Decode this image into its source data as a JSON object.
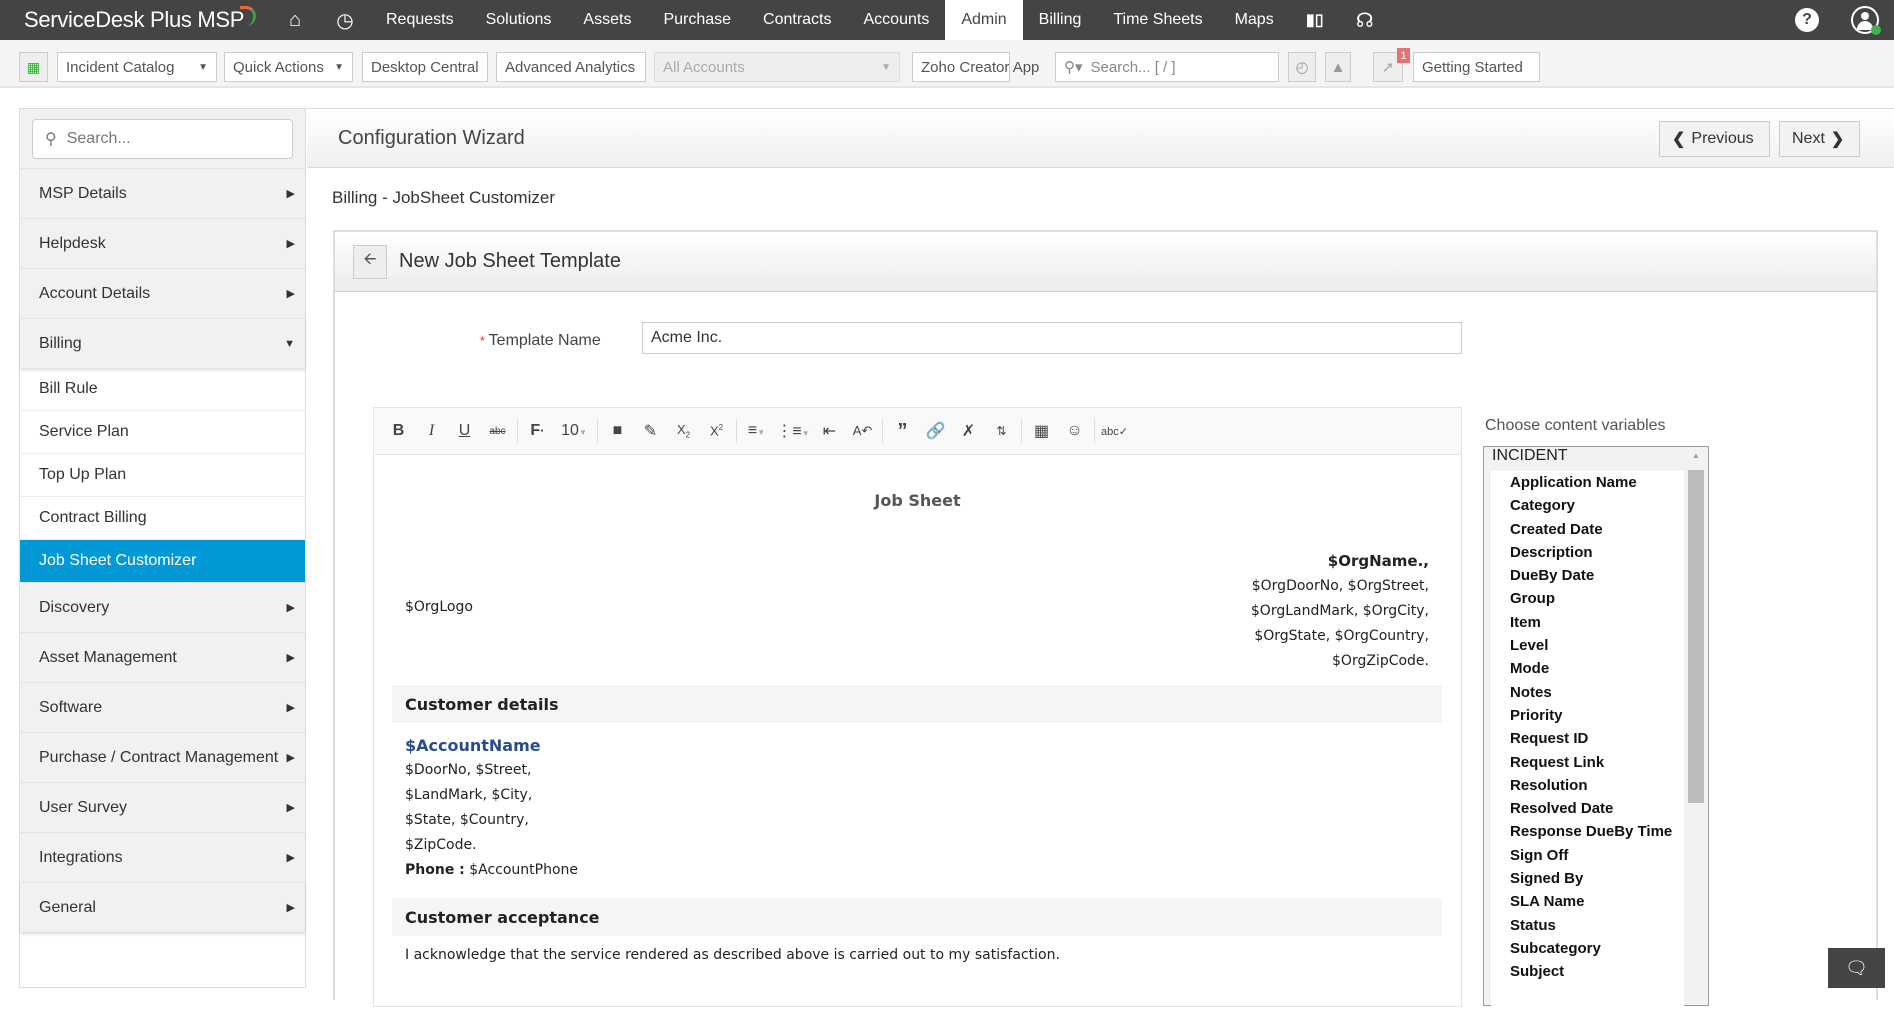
{
  "app": {
    "title": "ServiceDesk Plus MSP"
  },
  "topnav": {
    "items": [
      {
        "label": "Requests"
      },
      {
        "label": "Solutions"
      },
      {
        "label": "Assets"
      },
      {
        "label": "Purchase"
      },
      {
        "label": "Contracts"
      },
      {
        "label": "Accounts"
      },
      {
        "label": "Admin",
        "active": true
      },
      {
        "label": "Billing"
      },
      {
        "label": "Time Sheets"
      },
      {
        "label": "Maps"
      }
    ],
    "help_glyph": "?"
  },
  "toolbar": {
    "incident_catalog": "Incident Catalog",
    "quick_actions": "Quick Actions",
    "desktop_central": "Desktop Central",
    "advanced_analytics": "Advanced Analytics",
    "account_select": "All Accounts",
    "zoho_creator": "Zoho Creator App",
    "search_placeholder": "Search... [ / ]",
    "notification_count": "1",
    "getting_started": "Getting Started"
  },
  "sidebar": {
    "search_placeholder": "Search...",
    "items_top": [
      {
        "label": "MSP Details"
      },
      {
        "label": "Helpdesk"
      },
      {
        "label": "Account Details"
      },
      {
        "label": "Billing",
        "expanded": true
      }
    ],
    "billing_sub": [
      {
        "label": "Bill Rule"
      },
      {
        "label": "Service Plan"
      },
      {
        "label": "Top Up Plan"
      },
      {
        "label": "Contract Billing"
      },
      {
        "label": "Job Sheet Customizer",
        "selected": true
      }
    ],
    "items_bottom": [
      {
        "label": "Discovery"
      },
      {
        "label": "Asset Management"
      },
      {
        "label": "Software"
      },
      {
        "label": "Purchase / Contract Management"
      },
      {
        "label": "User Survey"
      },
      {
        "label": "Integrations"
      },
      {
        "label": "General"
      }
    ]
  },
  "wizard": {
    "title": "Configuration Wizard",
    "previous": "Previous",
    "next": "Next"
  },
  "breadcrumb": "Billing - JobSheet Customizer",
  "card": {
    "title": "New Job Sheet Template"
  },
  "form": {
    "template_name_label": "Template Name",
    "required_mark": "*",
    "template_name_value": "Acme Inc."
  },
  "editor": {
    "font_size": "10",
    "title": "Job Sheet",
    "org_logo": "$OrgLogo",
    "org_name": "$OrgName.,",
    "org_lines": [
      "$OrgDoorNo, $OrgStreet,",
      "$OrgLandMark, $OrgCity,",
      "$OrgState, $OrgCountry,",
      "$OrgZipCode."
    ],
    "section_customer": "Customer details",
    "account_name": "$AccountName",
    "account_lines": [
      "$DoorNo, $Street,",
      "$LandMark, $City,",
      "$State, $Country,",
      "$ZipCode."
    ],
    "phone_label": "Phone :",
    "phone_value": "$AccountPhone",
    "section_acceptance": "Customer acceptance",
    "acknowledgement": "I acknowledge that the service rendered as described above is carried out to my satisfaction."
  },
  "variables": {
    "label": "Choose content variables",
    "group": "INCIDENT",
    "items": [
      "Application Name",
      "Category",
      "Created Date",
      "Description",
      "DueBy Date",
      "Group",
      "Item",
      "Level",
      "Mode",
      "Notes",
      "Priority",
      "Request ID",
      "Request Link",
      "Resolution",
      "Resolved Date",
      "Response DueBy Time",
      "Sign Off",
      "Signed By",
      "SLA Name",
      "Status",
      "Subcategory",
      "Subject"
    ]
  },
  "colors": {
    "topbar": "#444444",
    "selected": "#0398d6",
    "accent_var": "#2b4c8c"
  }
}
